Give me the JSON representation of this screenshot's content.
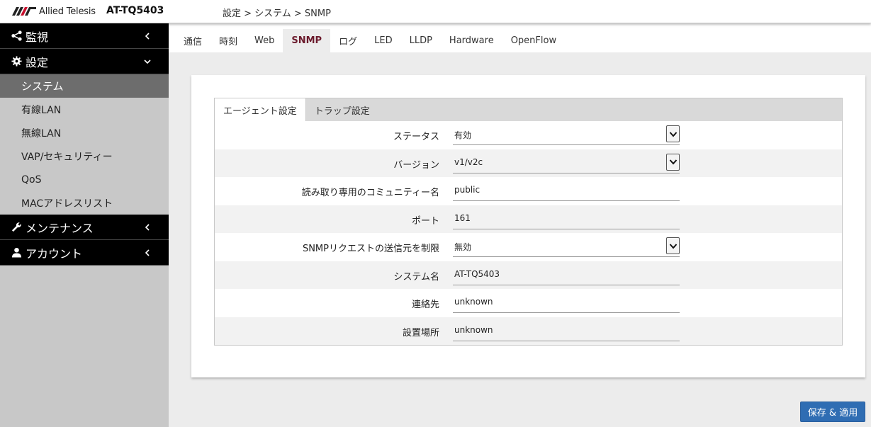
{
  "header": {
    "brand": "Allied Telesis",
    "model": "AT-TQ5403",
    "breadcrumb": "設定 > システム > SNMP"
  },
  "sidebar": {
    "sections": [
      {
        "label": "監視",
        "icon": "share-icon"
      },
      {
        "label": "設定",
        "icon": "gear-icon"
      },
      {
        "label": "メンテナンス",
        "icon": "wrench-icon"
      },
      {
        "label": "アカウント",
        "icon": "user-icon"
      }
    ],
    "items": [
      {
        "label": "システム",
        "active": true
      },
      {
        "label": "有線LAN"
      },
      {
        "label": "無線LAN"
      },
      {
        "label": "VAP/セキュリティー"
      },
      {
        "label": "QoS"
      },
      {
        "label": "MACアドレスリスト"
      }
    ]
  },
  "tabs": [
    "通信",
    "時刻",
    "Web",
    "SNMP",
    "ログ",
    "LED",
    "LLDP",
    "Hardware",
    "OpenFlow"
  ],
  "active_tab": "SNMP",
  "subtabs": [
    "エージェント設定",
    "トラップ設定"
  ],
  "form": [
    {
      "label": "ステータス",
      "value": "有効",
      "type": "select"
    },
    {
      "label": "バージョン",
      "value": "v1/v2c",
      "type": "select"
    },
    {
      "label": "読み取り専用のコミュニティー名",
      "value": "public",
      "type": "text"
    },
    {
      "label": "ポート",
      "value": "161",
      "type": "text"
    },
    {
      "label": "SNMPリクエストの送信元を制限",
      "value": "無効",
      "type": "select"
    },
    {
      "label": "システム名",
      "value": "AT-TQ5403",
      "type": "text"
    },
    {
      "label": "連絡先",
      "value": "unknown",
      "type": "text"
    },
    {
      "label": "設置場所",
      "value": "unknown",
      "type": "text"
    }
  ],
  "save_button": "保存 & 適用",
  "colors": {
    "active_tab": "#6b1a2c",
    "button": "#2f6db3",
    "sidebar_head": "#000000",
    "sidebar_active": "#6d6d6d"
  }
}
